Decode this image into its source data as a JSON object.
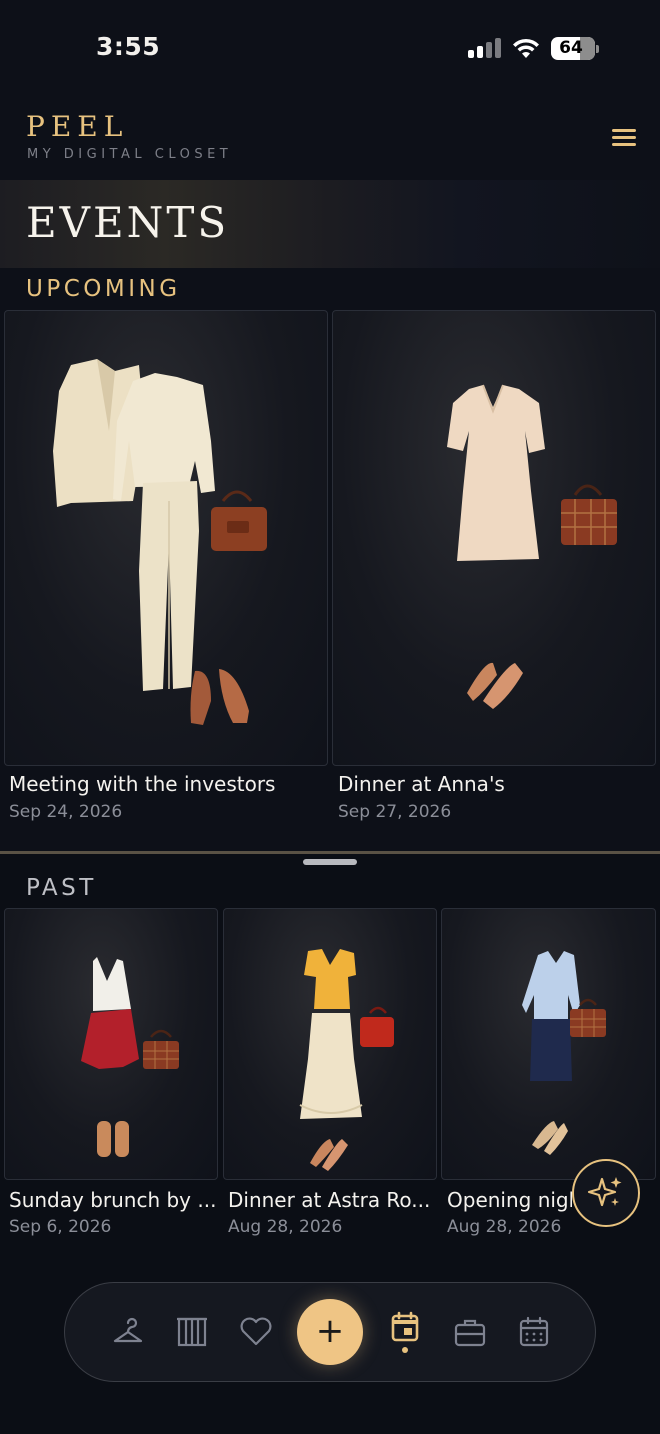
{
  "status_bar": {
    "time": "3:55",
    "battery": "64"
  },
  "header": {
    "brand": "PEEL",
    "tagline": "MY DIGITAL CLOSET"
  },
  "page": {
    "title": "EVENTS"
  },
  "upcoming": {
    "heading": "UPCOMING",
    "events": [
      {
        "title": "Meeting with the investors",
        "date": "Sep 24, 2026"
      },
      {
        "title": "Dinner at Anna's",
        "date": "Sep 27, 2026"
      }
    ]
  },
  "past": {
    "heading": "PAST",
    "events": [
      {
        "title": "Sunday brunch by ...",
        "date": "Sep 6, 2026"
      },
      {
        "title": "Dinner at Astra Ro...",
        "date": "Aug 28, 2026"
      },
      {
        "title": "Opening nigh",
        "date": "Aug 28, 2026"
      }
    ]
  },
  "nav": {
    "items": [
      "hanger-icon",
      "columns-icon",
      "heart-icon",
      "add-icon",
      "event-icon",
      "briefcase-icon",
      "calendar-icon"
    ],
    "add_label": "+",
    "active": "event-icon"
  },
  "colors": {
    "accent": "#e7c27f",
    "background": "#0d1018",
    "muted": "#8b8e98"
  }
}
